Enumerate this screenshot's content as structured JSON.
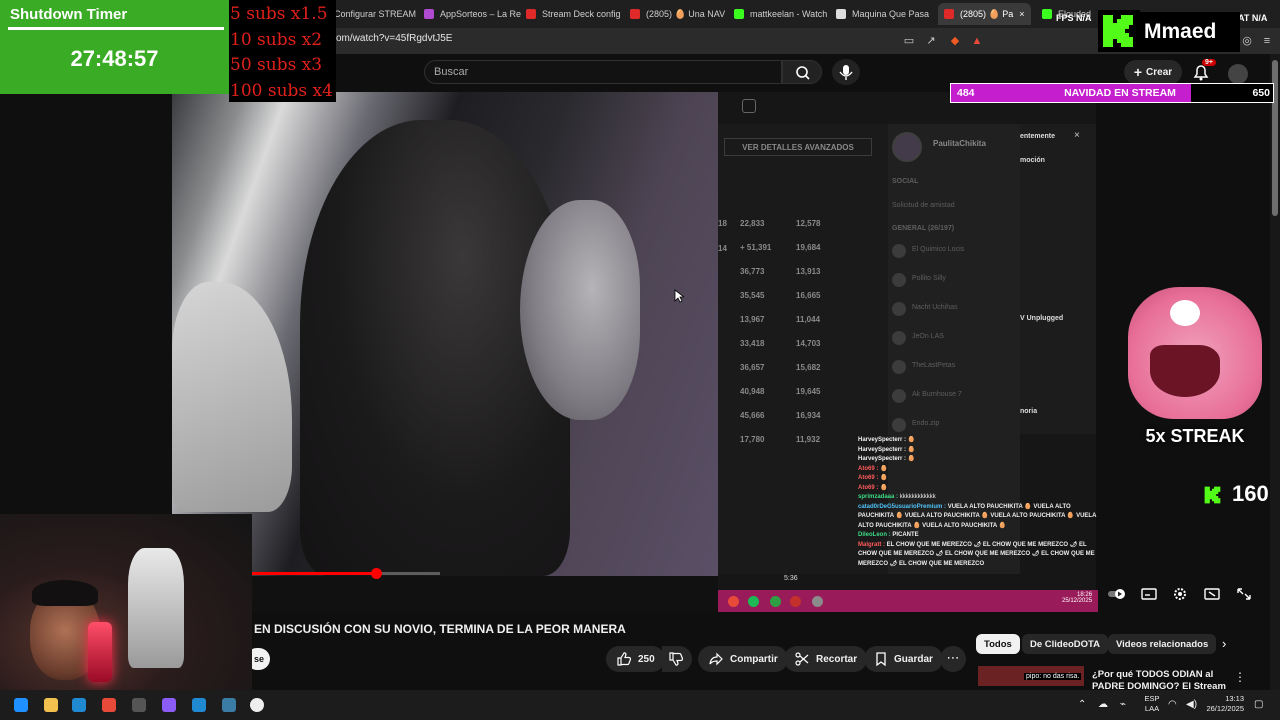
{
  "browser": {
    "tabs": [
      {
        "label": "Configurar STREAM",
        "color": "#e04b2c"
      },
      {
        "label": "AppSorteos – La Re",
        "color": "#b04ad0"
      },
      {
        "label": "Stream Deck config",
        "color": "#e02a2a"
      },
      {
        "label": "(2805) 🥚 Una NAV",
        "color": "#e02a2a"
      },
      {
        "label": "mattkeelan - Watch",
        "color": "#3aff1e"
      },
      {
        "label": "Maquina Que Pasa",
        "color": "#dddddd"
      },
      {
        "label": "(2805) 🥚 Pa",
        "color": "#e02a2a"
      },
      {
        "label": "Elouded",
        "color": "#3aff1e"
      }
    ],
    "url": "om/watch?v=45fRgdvtJ5E",
    "fps_label": "FPS",
    "fps_value": "N/A",
    "stat_label": "AT",
    "stat_value": "N/A"
  },
  "youtube": {
    "search_placeholder": "Buscar",
    "create_label": "Crear",
    "notif_count": "9+",
    "video_title": "EN DISCUSIÓN CON SU NOVIO, TERMINA DE LA PEOR MANERA",
    "subscribe_fragment": "se",
    "likes": "250",
    "share_label": "Compartir",
    "clip_label": "Recortar",
    "save_label": "Guardar",
    "progress_fraction": 0.66,
    "chips": [
      "Todos",
      "De ClideoDOTA",
      "Videos relacionados"
    ],
    "related_title": "¿Por qué TODOS ODIAN al PADRE DOMINGO? El Stream",
    "related_overlay": "pipo: no das risa."
  },
  "game": {
    "advanced_button": "VER DETALLES AVANZADOS",
    "stats": [
      [
        "22,833",
        "12,578"
      ],
      [
        "+ 51,391",
        "19,684"
      ],
      [
        "36,773",
        "13,913"
      ],
      [
        "35,545",
        "16,665"
      ],
      [
        "13,967",
        "11,044"
      ],
      [
        "33,418",
        "14,703"
      ],
      [
        "36,657",
        "15,682"
      ],
      [
        "40,948",
        "19,645"
      ],
      [
        "45,666",
        "16,934"
      ],
      [
        "17,780",
        "11,932"
      ]
    ],
    "left_edge_numbers": [
      "18",
      "14"
    ],
    "player_time": "5:36",
    "friend_name": "PaulitaChikita",
    "friend_section": "SOCIAL",
    "friend_request": "Solicitud de amistad",
    "friend_group": "GENERAL (26/197)",
    "friends": [
      "El Quimico Locis",
      "Pollito Silly",
      "Nacht Uchihas",
      "JeOn LAS",
      "TheLastPetas",
      "Ak Burnhouse 7",
      "Endo.zip"
    ],
    "side_items": [
      "entemente",
      "moción",
      "V Unplugged",
      "noria"
    ],
    "clock_time": "18:26",
    "clock_date": "25/12/2025"
  },
  "chat": [
    {
      "user": "HarveySpecterr :",
      "msg": "🥚",
      "color": "#f2f2f2"
    },
    {
      "user": "HarveySpecterr :",
      "msg": "🥚",
      "color": "#f2f2f2"
    },
    {
      "user": "HarveySpecterr :",
      "msg": "🥚",
      "color": "#f2f2f2"
    },
    {
      "user": "Ato69 :",
      "msg": "🥚",
      "color": "#ff5a5a"
    },
    {
      "user": "Ato69 :",
      "msg": "🥚",
      "color": "#ff5a5a"
    },
    {
      "user": "Ato69 :",
      "msg": "🥚",
      "color": "#ff5a5a"
    },
    {
      "user": "sprimzadaaa :",
      "msg": "kkkkkkkkkkkk",
      "color": "#3ddc84"
    },
    {
      "user": "catad0rDeG5usuarioPremium :",
      "msg": "VUELA ALTO PAUCHIKITA 🥚 VUELA ALTO PAUCHIKITA 🥚 VUELA ALTO PAUCHIKITA 🥚 VUELA ALTO PAUCHIKITA 🥚 VUELA ALTO PAUCHIKITA 🥚 VUELA ALTO PAUCHIKITA 🥚",
      "color": "#4fc3f7"
    },
    {
      "user": "DileoLeon :",
      "msg": "PICANTE",
      "color": "#3ddc84"
    },
    {
      "user": "Malgratt :",
      "msg": "EL CHOW QUE ME MEREZCO 🌶 EL CHOW QUE ME MEREZCO 🌶 EL CHOW QUE ME MEREZCO 🌶 EL CHOW QUE ME MEREZCO 🌶 EL CHOW QUE ME MEREZCO 🌶 EL CHOW QUE ME MEREZCO",
      "color": "#ff5a5a"
    }
  ],
  "overlay": {
    "timer_label": "Shutdown Timer",
    "timer_value": "27:48:57",
    "subs": [
      "5 subs x1.5",
      "10 subs x2",
      "50 subs x3",
      "100 subs x4"
    ],
    "kick_user": "Mmaed",
    "goal_current": "484",
    "goal_title": "NAVIDAD EN STREAM",
    "goal_max": "650",
    "goal_fraction": 0.745,
    "streak_label": "5x STREAK",
    "kick_count": "160",
    "kick_green": "#53fc18",
    "goal_color": "#c51ecf"
  },
  "taskbar": {
    "lang": "ESP",
    "lang_sub": "LAA",
    "time": "13:13",
    "date": "26/12/2025"
  }
}
